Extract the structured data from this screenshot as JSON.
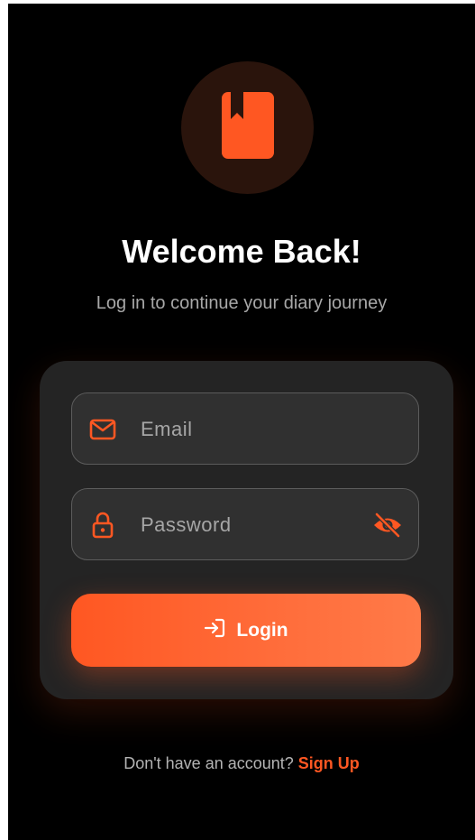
{
  "header": {
    "logo_icon": "bookmark-book-icon",
    "title": "Welcome Back!",
    "subtitle": "Log in to continue your diary journey"
  },
  "form": {
    "email": {
      "icon": "mail-icon",
      "placeholder": "Email",
      "value": ""
    },
    "password": {
      "icon": "lock-icon",
      "placeholder": "Password",
      "value": "",
      "toggle_icon": "eye-off-icon"
    },
    "login_button": {
      "icon": "login-icon",
      "label": "Login"
    }
  },
  "footer": {
    "prompt": "Don't have an account?",
    "signup_link": "Sign Up"
  },
  "colors": {
    "accent": "#FF5722",
    "background": "#000000",
    "card": "#242424",
    "field": "#303030",
    "text_muted": "#A8A8A8"
  }
}
